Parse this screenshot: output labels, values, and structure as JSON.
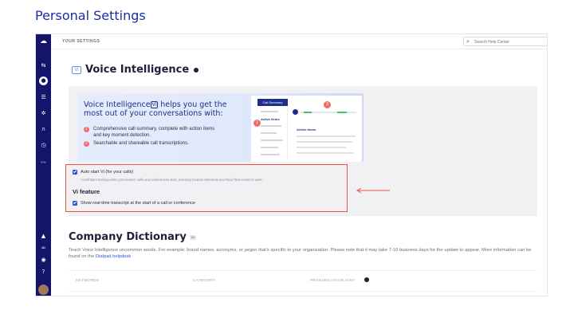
{
  "page_heading": "Personal Settings",
  "topbar": {
    "section_label": "YOUR SETTINGS",
    "search_placeholder": "Search Help Center"
  },
  "sidebar": {
    "icons": [
      "dialpad-logo-icon",
      "call-routing-icon",
      "user-icon",
      "channels-icon",
      "settings-icon",
      "headset-icon",
      "history-icon",
      "analytics-icon",
      "bell-icon",
      "voicemail-icon",
      "contacts-icon",
      "help-icon"
    ]
  },
  "vi_section": {
    "badge": "Vi",
    "title": "Voice Intelligence"
  },
  "promo": {
    "headline_pre": "Voice Intelligence",
    "headline_badge": "Vi",
    "headline_post": "helps you get the most out of your conversations with:",
    "bullets": [
      {
        "num": "1",
        "text": "Comprehensive call summary, complete with action items and key moment detection."
      },
      {
        "num": "2",
        "text": "Searchable and shareable call transcriptions."
      }
    ],
    "mock": {
      "tab": "Call Summary",
      "side_active": "Active Items",
      "main_label": "Action Items",
      "badge_1": "1",
      "badge_2": "2"
    }
  },
  "settings": {
    "auto_start_label": "Auto start Vi (for your calls)",
    "auto_start_checked": true,
    "auto_start_desc": "Vi will start working when your teams' calls and conferences start, ensuring Custom Moments and Real Time Assist to work.",
    "feature_title": "Vi feature",
    "realtime_label": "Show real-time transcript at the start of a call or conference",
    "realtime_checked": true
  },
  "dictionary": {
    "title": "Company Dictionary",
    "badge": "Vi",
    "desc_pre": "Teach Voice Intelligence uncommon words. For example: brand names, acronyms, or jargon that's specific to your organization. Please note that it may take 7-10 business days for the update to appear. More information can be found on the",
    "desc_link": "Dialpad helpdesk",
    "columns": [
      "KEYWORDS",
      "CATEGORY",
      "PRONUNCIATION HINT"
    ]
  },
  "colors": {
    "sidebar": "#14146a",
    "brand_blue": "#1b2fa0",
    "highlight_red": "#e2564d",
    "checkbox_blue": "#2a57d6"
  }
}
